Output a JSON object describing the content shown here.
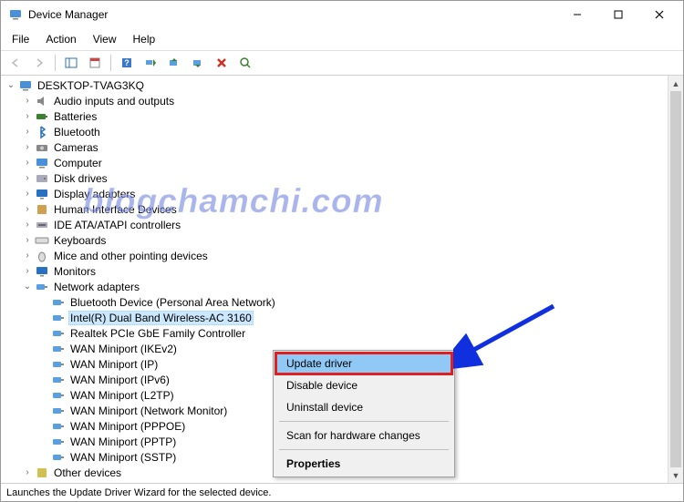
{
  "window": {
    "title": "Device Manager"
  },
  "menu": {
    "file": "File",
    "action": "Action",
    "view": "View",
    "help": "Help"
  },
  "tree": {
    "root": {
      "label": "DESKTOP-TVAG3KQ"
    },
    "categories": [
      {
        "label": "Audio inputs and outputs"
      },
      {
        "label": "Batteries"
      },
      {
        "label": "Bluetooth"
      },
      {
        "label": "Cameras"
      },
      {
        "label": "Computer"
      },
      {
        "label": "Disk drives"
      },
      {
        "label": "Display adapters"
      },
      {
        "label": "Human Interface Devices"
      },
      {
        "label": "IDE ATA/ATAPI controllers"
      },
      {
        "label": "Keyboards"
      },
      {
        "label": "Mice and other pointing devices"
      },
      {
        "label": "Monitors"
      },
      {
        "label": "Network adapters",
        "expanded": true
      },
      {
        "label": "Other devices"
      }
    ],
    "network_children": [
      {
        "label": "Bluetooth Device (Personal Area Network)"
      },
      {
        "label": "Intel(R) Dual Band Wireless-AC 3160",
        "selected": true
      },
      {
        "label": "Realtek PCIe GbE Family Controller"
      },
      {
        "label": "WAN Miniport (IKEv2)"
      },
      {
        "label": "WAN Miniport (IP)"
      },
      {
        "label": "WAN Miniport (IPv6)"
      },
      {
        "label": "WAN Miniport (L2TP)"
      },
      {
        "label": "WAN Miniport (Network Monitor)"
      },
      {
        "label": "WAN Miniport (PPPOE)"
      },
      {
        "label": "WAN Miniport (PPTP)"
      },
      {
        "label": "WAN Miniport (SSTP)"
      }
    ]
  },
  "context_menu": {
    "update": "Update driver",
    "disable": "Disable device",
    "uninstall": "Uninstall device",
    "scan": "Scan for hardware changes",
    "properties": "Properties"
  },
  "statusbar": {
    "text": "Launches the Update Driver Wizard for the selected device."
  },
  "watermark": {
    "text": "blogchamchi.com"
  }
}
